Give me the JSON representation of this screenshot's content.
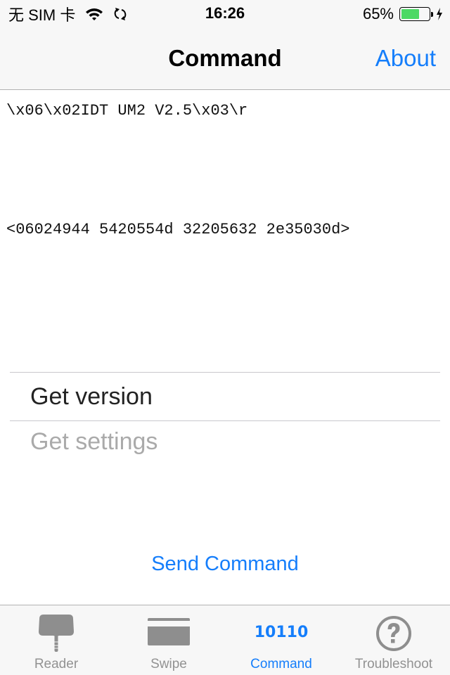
{
  "status_bar": {
    "carrier": "无 SIM 卡",
    "wifi_icon": "wifi-icon",
    "sync_icon": "sync-icon",
    "time": "16:26",
    "battery_percent_label": "65%",
    "battery_level": 0.65,
    "charging_icon": "bolt-icon",
    "battery_color": "#4cd964"
  },
  "nav": {
    "title": "Command",
    "about_label": "About",
    "accent_color": "#157efb"
  },
  "output": {
    "ascii": "\\x06\\x02IDT UM2 V2.5\\x03\\r",
    "hex": "<06024944 5420554d 32205632 2e35030d>"
  },
  "picker": {
    "items": [
      {
        "label": "Get version",
        "selected": true
      },
      {
        "label": "Get settings",
        "selected": false
      }
    ]
  },
  "send_button": {
    "label": "Send Command"
  },
  "tab_bar": {
    "tabs": [
      {
        "label": "Reader",
        "icon": "card-reader-icon",
        "active": false
      },
      {
        "label": "Swipe",
        "icon": "credit-card-icon",
        "active": false
      },
      {
        "label": "Command",
        "icon": "binary-icon",
        "icon_text": "10110",
        "active": true
      },
      {
        "label": "Troubleshoot",
        "icon": "question-circle-icon",
        "active": false
      }
    ]
  }
}
